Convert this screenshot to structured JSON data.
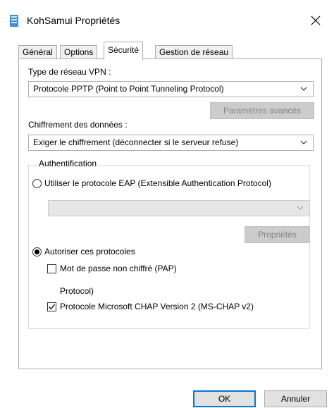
{
  "window": {
    "title": "KohSamui Propriétés"
  },
  "tabs": [
    {
      "label": "Général"
    },
    {
      "label": "Options"
    },
    {
      "label": "Sécurité"
    },
    {
      "label": "Gestion de réseau"
    }
  ],
  "vpn": {
    "type_label": "Type de réseau VPN :",
    "type_value": "Protocole PPTP (Point to Point Tunneling Protocol)",
    "advanced_button": "Paramètres avancés"
  },
  "encryption": {
    "label": "Chiffrement des données :",
    "value": "Exiger le chiffrement (déconnecter si le serveur refuse)"
  },
  "auth": {
    "group_label": "Authentification",
    "eap_radio_label": "Utiliser le protocole EAP (Extensible Authentication Protocol)",
    "eap_combo_value": "",
    "properties_button": "Propriétés",
    "allow_radio_label": "Autoriser ces protocoles",
    "pap_label": "Mot de passe non chiffré (PAP)",
    "clipped_text": "Protocol)",
    "mschap_label": "Protocole Microsoft CHAP Version 2 (MS-CHAP v2)"
  },
  "footer": {
    "ok_button": "OK",
    "cancel_button": "Annuler"
  },
  "colors": {
    "accent": "#0078d7",
    "icon": "#3c8fd6"
  }
}
